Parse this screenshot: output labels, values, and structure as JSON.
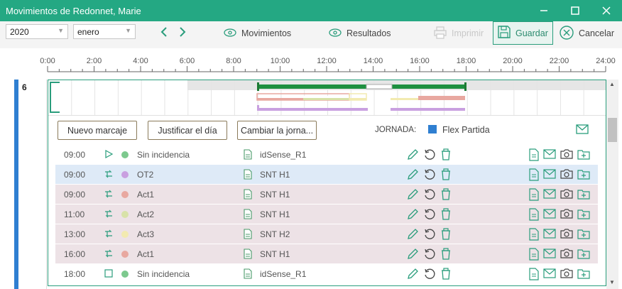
{
  "window": {
    "title": "Movimientos de Redonnet, Marie"
  },
  "toolbar": {
    "year": "2020",
    "month": "enero",
    "movimientos_label": "Movimientos",
    "resultados_label": "Resultados",
    "imprimir_label": "Imprimir",
    "guardar_label": "Guardar",
    "cancelar_label": "Cancelar"
  },
  "ruler": {
    "labels": [
      "0:00",
      "2:00",
      "4:00",
      "6:00",
      "8:00",
      "10:00",
      "12:00",
      "14:00",
      "16:00",
      "18:00",
      "20:00",
      "22:00",
      "24:00"
    ]
  },
  "day": {
    "number": "6"
  },
  "actions": {
    "nuevo_marcaje": "Nuevo marcaje",
    "justificar": "Justificar el día",
    "cambiar": "Cambiar la jorna...",
    "jornada_label": "JORNADA:",
    "jornada_value": "Flex Partida"
  },
  "colors": {
    "accent": "#24a883",
    "day_bar": "#2f7fd1"
  },
  "rows": [
    {
      "time": "09:00",
      "incidence": "Sin incidencia",
      "terminal": "idSense_R1",
      "dot": "#7dc98e",
      "icon": "play-icon",
      "bg": "white"
    },
    {
      "time": "09:00",
      "incidence": "OT2",
      "terminal": "SNT H1",
      "dot": "#c9a0e0",
      "icon": "transfer-icon",
      "bg": "blue"
    },
    {
      "time": "09:00",
      "incidence": "Act1",
      "terminal": "SNT H1",
      "dot": "#e8a8a0",
      "icon": "transfer-icon",
      "bg": "pink"
    },
    {
      "time": "11:00",
      "incidence": "Act2",
      "terminal": "SNT H1",
      "dot": "#d8e2a8",
      "icon": "transfer-icon",
      "bg": "pink"
    },
    {
      "time": "13:00",
      "incidence": "Act3",
      "terminal": "SNT H2",
      "dot": "#f2eab0",
      "icon": "transfer-icon",
      "bg": "pink"
    },
    {
      "time": "16:00",
      "incidence": "Act1",
      "terminal": "SNT H1",
      "dot": "#e8a8a0",
      "icon": "transfer-icon",
      "bg": "pink"
    },
    {
      "time": "18:00",
      "incidence": "Sin incidencia",
      "terminal": "idSense_R1",
      "dot": "#7dc98e",
      "icon": "stop-icon",
      "bg": "white"
    }
  ]
}
